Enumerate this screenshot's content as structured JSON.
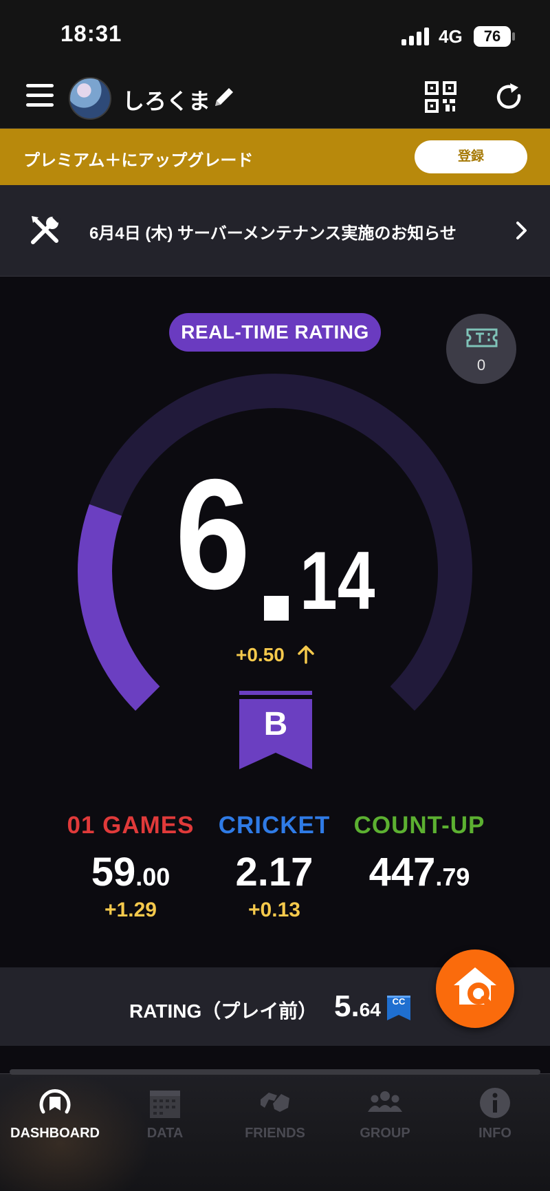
{
  "status_bar": {
    "time": "18:31",
    "network": "4G",
    "battery": "76"
  },
  "header": {
    "username": "しろくま"
  },
  "premium_banner": {
    "text": "プレミアム＋にアップグレード",
    "button": "登録"
  },
  "notice": {
    "text": "6月4日 (木) サーバーメンテナンス実施のお知らせ"
  },
  "rating": {
    "title": "REAL-TIME RATING",
    "ticket_count": "0",
    "value_int": "6",
    "value_dec": "14",
    "delta": "+0.50",
    "rank": "B",
    "gauge_fraction": 0.24
  },
  "stats": [
    {
      "title": "01 GAMES",
      "value_big": "59",
      "value_small": ".00",
      "delta": "+1.29",
      "color": "#e03a3a"
    },
    {
      "title": "CRICKET",
      "value_big": "2.17",
      "value_small": "",
      "delta": "+0.13",
      "color": "#2f7be6"
    },
    {
      "title": "COUNT-UP",
      "value_big": "447",
      "value_small": ".79",
      "delta": "",
      "color": "#5cb031"
    }
  ],
  "pre_play": {
    "label": "RATING（プレイ前）",
    "value_big": "5.",
    "value_small": "64",
    "badge": "CC"
  },
  "tabs": [
    {
      "label": "DASHBOARD",
      "icon": "dashboard-icon",
      "active": true
    },
    {
      "label": "DATA",
      "icon": "calendar-icon",
      "active": false
    },
    {
      "label": "FRIENDS",
      "icon": "friends-icon",
      "active": false
    },
    {
      "label": "GROUP",
      "icon": "group-icon",
      "active": false
    },
    {
      "label": "INFO",
      "icon": "info-icon",
      "active": false
    }
  ],
  "colors": {
    "accent_purple": "#6a3bc0",
    "gold": "#b8890c",
    "orange": "#fa6b0c",
    "delta_yellow": "#f5c94c"
  }
}
